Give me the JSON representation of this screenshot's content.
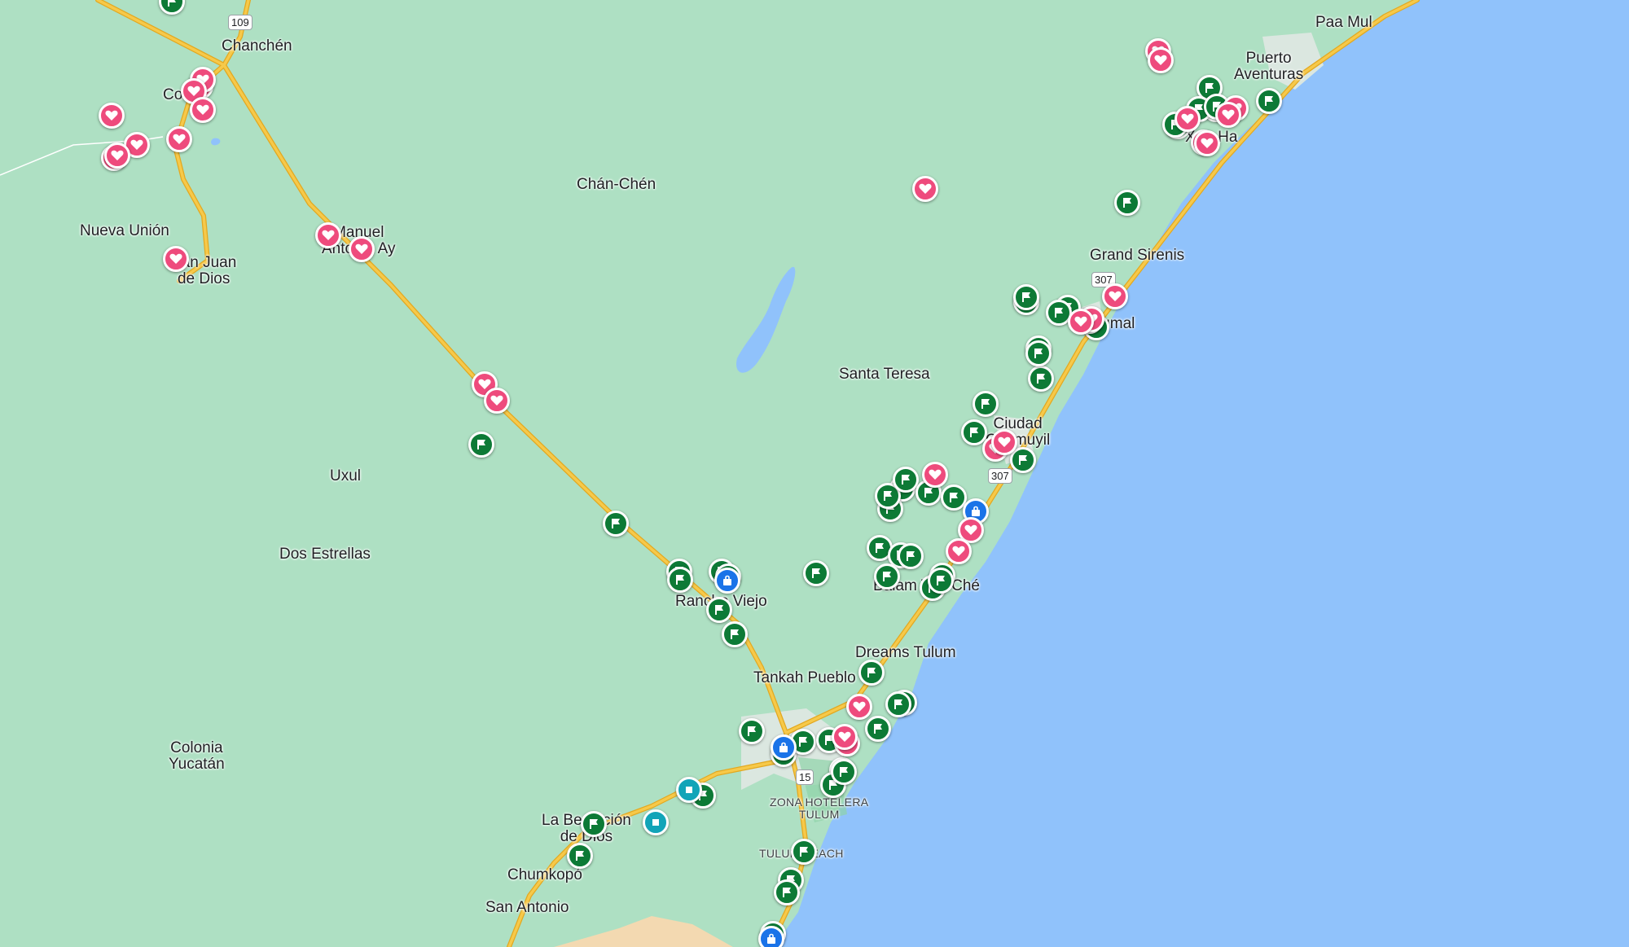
{
  "map": {
    "colors": {
      "land": "#aee0c3",
      "water": "#90c2fb",
      "road": "#f6c94a",
      "road_outline": "#e3a820",
      "urban": "#dbe7e0",
      "saved_pin": "#ee4b7d",
      "flag_pin": "#0d7a36",
      "blue_pin": "#1a73e8",
      "teal_pin": "#12a4b8"
    },
    "place_labels": [
      {
        "id": "chanchen",
        "text": "Chanchén"
      },
      {
        "id": "paa-mul",
        "text": "Paa Mul"
      },
      {
        "id": "puerto-aventuras",
        "text": "Puerto\nAventuras"
      },
      {
        "id": "co",
        "text": "Co"
      },
      {
        "id": "chan-chen",
        "text": "Chán-Chén"
      },
      {
        "id": "nueva-union",
        "text": "Nueva Unión"
      },
      {
        "id": "manuel-antonio-ay",
        "text": "Manuel\nAntonio Ay"
      },
      {
        "id": "san-juan-de-dios",
        "text": "San Juan\nde Dios"
      },
      {
        "id": "grand-sirenis",
        "text": "Grand Sirenis"
      },
      {
        "id": "akumal",
        "text": "Akumal"
      },
      {
        "id": "xpu-ha",
        "text": "Xpu-Ha"
      },
      {
        "id": "santa-teresa",
        "text": "Santa Teresa"
      },
      {
        "id": "ciudad-chemuyil",
        "text": "Ciudad\nChemuyil"
      },
      {
        "id": "uxul",
        "text": "Uxul"
      },
      {
        "id": "dos-estrellas",
        "text": "Dos Estrellas"
      },
      {
        "id": "balam-tun-che",
        "text": "Balam Tun Ché"
      },
      {
        "id": "rancho-viejo",
        "text": "Rancho Viejo"
      },
      {
        "id": "dreams-tulum",
        "text": "Dreams Tulum"
      },
      {
        "id": "tankah-pueblo",
        "text": "Tankah Pueblo"
      },
      {
        "id": "colonia-yucatan",
        "text": "Colonia\nYucatán"
      },
      {
        "id": "zona-hotelera-tulum",
        "text": "ZONA HOTELERA\nTULUM"
      },
      {
        "id": "la-bendicion-de-dios",
        "text": "La Bendición\nde Dios"
      },
      {
        "id": "tulum-beach",
        "text": "TULUM BEACH"
      },
      {
        "id": "chumkopo",
        "text": "Chumkopó"
      },
      {
        "id": "san-antonio",
        "text": "San Antonio"
      }
    ],
    "road_shields": [
      {
        "id": "hwy-109",
        "text": "109"
      },
      {
        "id": "hwy-307-north",
        "text": "307"
      },
      {
        "id": "hwy-307-south",
        "text": "307"
      },
      {
        "id": "hwy-15",
        "text": "15"
      }
    ],
    "pin_groups": {
      "saved": "heart-icon",
      "starred": "flag-icon",
      "blue": "bag-icon",
      "teal": "square-icon"
    }
  }
}
